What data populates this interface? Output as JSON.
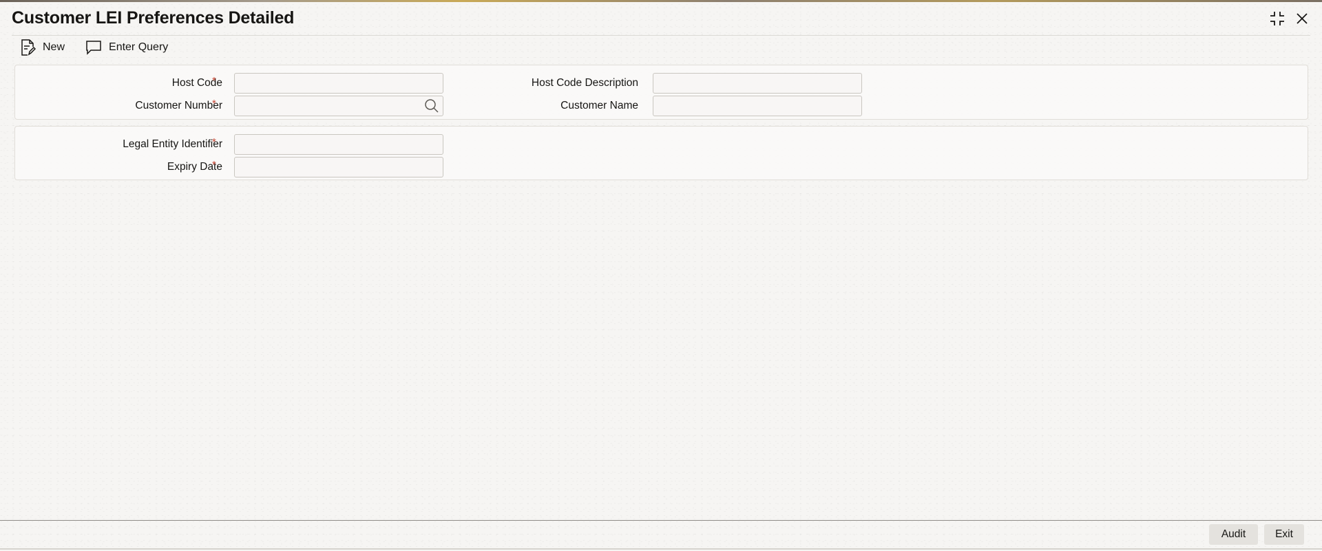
{
  "window": {
    "title": "Customer LEI Preferences Detailed"
  },
  "toolbar": {
    "new_label": "New",
    "enter_query_label": "Enter Query"
  },
  "form": {
    "host_code": {
      "label": "Host Code",
      "required": "*",
      "value": ""
    },
    "host_code_description": {
      "label": "Host Code Description",
      "value": ""
    },
    "customer_number": {
      "label": "Customer Number",
      "required": "*",
      "value": ""
    },
    "customer_name": {
      "label": "Customer Name",
      "value": ""
    },
    "legal_entity_identifier": {
      "label": "Legal Entity Identifier",
      "required": "*",
      "value": ""
    },
    "expiry_date": {
      "label": "Expiry Date",
      "required": "*",
      "value": ""
    }
  },
  "footer": {
    "audit_label": "Audit",
    "exit_label": "Exit"
  },
  "icons": {
    "new": "document-edit-icon",
    "enter_query": "speech-bubble-icon",
    "search": "search-icon",
    "maximize": "maximize-icon",
    "close": "close-icon"
  },
  "colors": {
    "required_marker": "#c74634",
    "background": "#f6f5f3",
    "button_bg": "#e4e2de"
  }
}
